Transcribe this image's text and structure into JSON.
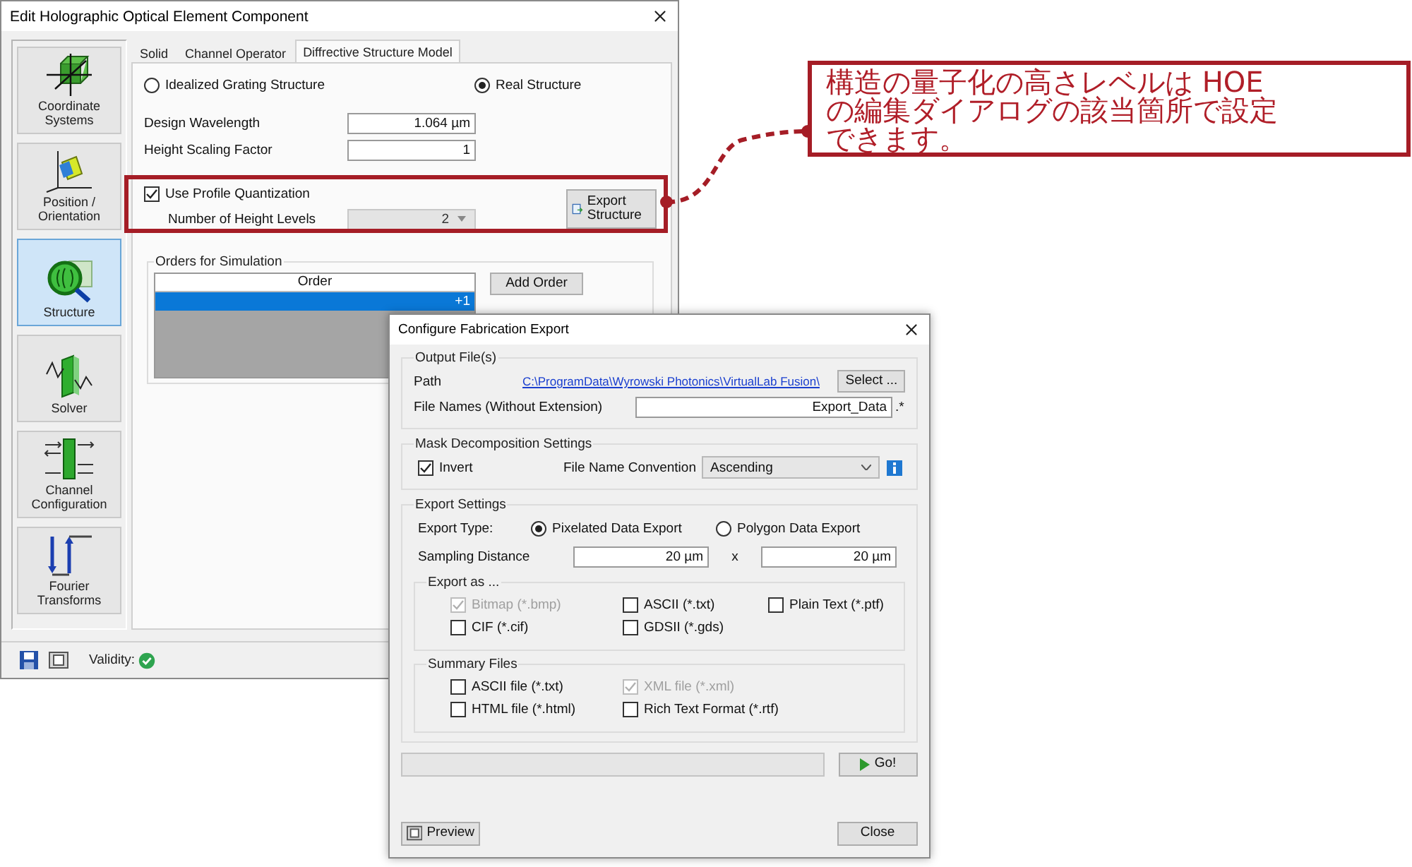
{
  "main_dialog": {
    "title": "Edit Holographic Optical Element Component",
    "nav": [
      {
        "label": "Coordinate Systems",
        "selected": false
      },
      {
        "label": "Position / Orientation",
        "selected": false
      },
      {
        "label": "Structure",
        "selected": true
      },
      {
        "label": "Solver",
        "selected": false
      },
      {
        "label": "Channel Configuration",
        "selected": false
      },
      {
        "label": "Fourier Transforms",
        "selected": false
      }
    ],
    "tabs": [
      {
        "label": "Solid",
        "selected": false
      },
      {
        "label": "Channel Operator",
        "selected": false
      },
      {
        "label": "Diffrective Structure Model",
        "selected": true
      }
    ],
    "structure_type": [
      {
        "label": "Idealized Grating Structure",
        "selected": false
      },
      {
        "label": "Real Structure",
        "selected": true
      }
    ],
    "fields": [
      {
        "label": "Design Wavelength",
        "value": "1.064 µm"
      },
      {
        "label": "Height Scaling Factor",
        "value": "1"
      }
    ],
    "quantization": {
      "label": "Use Profile Quantization",
      "checked": true,
      "levels_label": "Number of Height Levels",
      "levels_value": "2",
      "export_button": "Export Structure"
    },
    "orders": {
      "title": "Orders for Simulation",
      "column": "Order",
      "rows": [
        {
          "value": "+1",
          "selected": true
        }
      ],
      "add_button": "Add Order"
    },
    "status": {
      "validity_label": "Validity:"
    }
  },
  "export_dialog": {
    "title": "Configure Fabrication Export",
    "output": {
      "title": "Output File(s)",
      "path_label": "Path",
      "path": "C:\\ProgramData\\Wyrowski Photonics\\VirtualLab Fusion\\",
      "select_button": "Select ...",
      "names_label": "File Names (Without Extension)",
      "names_value": "Export_Data",
      "extension": ".*"
    },
    "mask": {
      "title": "Mask Decomposition Settings",
      "invert_label": "Invert",
      "invert_checked": true,
      "convention_label": "File Name Convention",
      "convention_value": "Ascending"
    },
    "export": {
      "title": "Export Settings",
      "type_label": "Export Type:",
      "types": [
        {
          "label": "Pixelated Data Export",
          "selected": true
        },
        {
          "label": "Polygon Data Export",
          "selected": false
        }
      ],
      "sampling_label": "Sampling Distance",
      "sampling_x": "20 µm",
      "times": "x",
      "sampling_y": "20 µm",
      "formats": {
        "title": "Export as ...",
        "items": [
          {
            "label": "Bitmap (*.bmp)",
            "checked": true,
            "disabled": true
          },
          {
            "label": "ASCII (*.txt)",
            "checked": false,
            "disabled": false
          },
          {
            "label": "Plain Text (*.ptf)",
            "checked": false,
            "disabled": false
          },
          {
            "label": "CIF (*.cif)",
            "checked": false,
            "disabled": false
          },
          {
            "label": "GDSII (*.gds)",
            "checked": false,
            "disabled": false
          }
        ]
      },
      "summary": {
        "title": "Summary Files",
        "items": [
          {
            "label": "ASCII file (*.txt)",
            "checked": false,
            "disabled": false
          },
          {
            "label": "XML file (*.xml)",
            "checked": true,
            "disabled": true
          },
          {
            "label": "HTML file (*.html)",
            "checked": false,
            "disabled": false
          },
          {
            "label": "Rich Text Format (*.rtf)",
            "checked": false,
            "disabled": false
          }
        ]
      }
    },
    "progress": {
      "level": 0
    },
    "go_button": "Go!",
    "preview_button": "Preview",
    "close_button": "Close"
  },
  "callout": {
    "text": "構造の量子化の高さレベルは HOE の編集ダイアログの該当箇所で設定できます。"
  }
}
